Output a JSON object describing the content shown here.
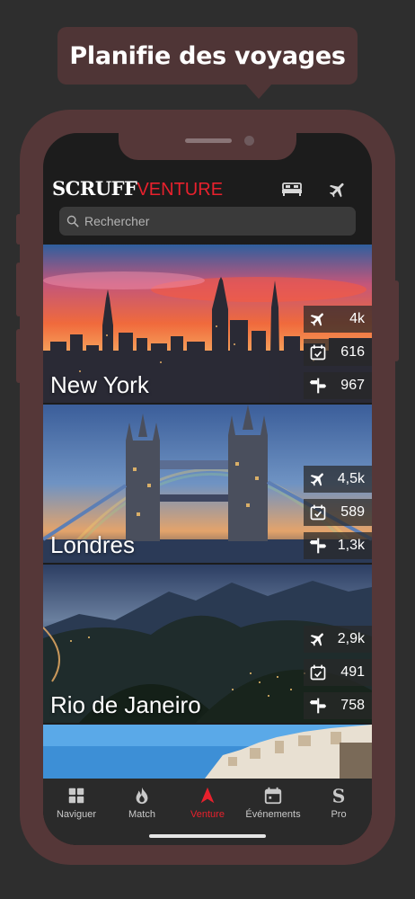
{
  "banner": {
    "title": "Planifie des voyages"
  },
  "app": {
    "logo_part1": "SCRUFF",
    "logo_part2": "VENTURE",
    "accent": "#e8212d"
  },
  "header": {
    "icons": [
      "bed-icon",
      "plane-icon"
    ]
  },
  "search": {
    "placeholder": "Rechercher"
  },
  "destinations": [
    {
      "name": "New York",
      "flights": "4k",
      "dates": "616",
      "places": "967"
    },
    {
      "name": "Londres",
      "flights": "4,5k",
      "dates": "589",
      "places": "1,3k"
    },
    {
      "name": "Rio de Janeiro",
      "flights": "2,9k",
      "dates": "491",
      "places": "758"
    }
  ],
  "tabs": [
    {
      "label": "Naviguer",
      "icon": "grid-icon"
    },
    {
      "label": "Match",
      "icon": "flame-icon"
    },
    {
      "label": "Venture",
      "icon": "compass-arrow-icon",
      "active": true
    },
    {
      "label": "Événements",
      "icon": "calendar-icon"
    },
    {
      "label": "Pro",
      "icon": "scruff-s-icon"
    }
  ]
}
